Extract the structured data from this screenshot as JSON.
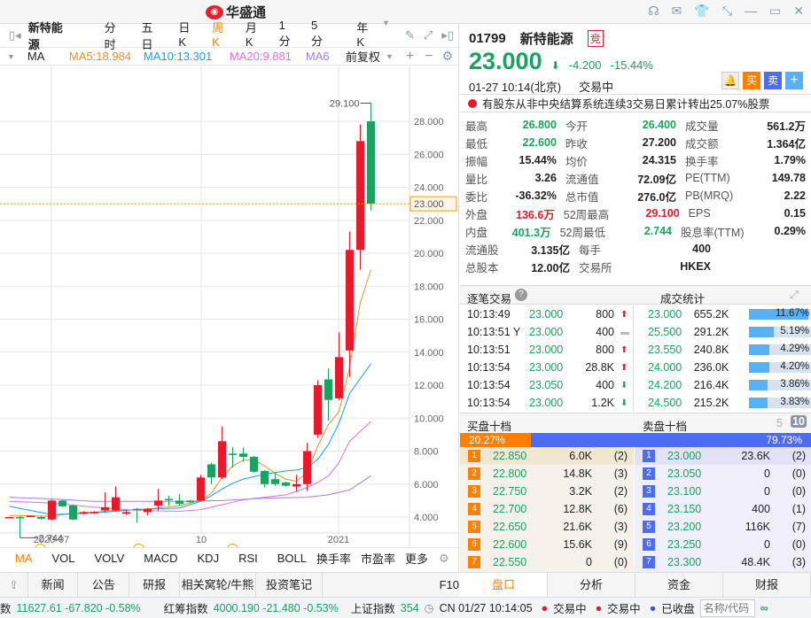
{
  "app": {
    "logo_text": "华盛通"
  },
  "toolbar": {
    "stock_name": "新特能源",
    "periods": [
      "分时",
      "五日",
      "日K",
      "周K",
      "月K",
      "1分",
      "5分",
      "年K"
    ],
    "active_period": "周K"
  },
  "ma_row": {
    "label": "MA",
    "ma5": "MA5:18.984",
    "ma10": "MA10:13.301",
    "ma20": "MA20:9.881",
    "ma60": "MA6",
    "adjust": "前复权"
  },
  "chart_data": {
    "type": "candlestick",
    "yticks": [
      4,
      6,
      8,
      10,
      12,
      14,
      16,
      18,
      20,
      22,
      24,
      26,
      28
    ],
    "ytick_labels": [
      "4.000",
      "6.000",
      "8.000",
      "10.000",
      "12.000",
      "14.000",
      "16.000",
      "18.000",
      "20.000",
      "22.000",
      "24.000",
      "26.000",
      "28.000"
    ],
    "ylim": [
      2.3,
      29.4
    ],
    "current_price_label": "23.000",
    "current_price": 23.0,
    "high_label": "29.100",
    "low_label": "2.744",
    "xlabels": [
      {
        "text": "2020-07",
        "index": 4
      },
      {
        "text": "10",
        "index": 18
      },
      {
        "text": "2021",
        "index": 31
      }
    ],
    "events": [
      {
        "text": "Q",
        "index": 3
      },
      {
        "text": "E",
        "index": 12
      },
      {
        "text": "E",
        "index": 21
      }
    ],
    "up_color": "#e8192c",
    "down_color": "#1aa260",
    "candles": [
      [
        4.0,
        4.0,
        4.02,
        3.97
      ],
      [
        4.0,
        3.95,
        4.05,
        2.744
      ],
      [
        4.05,
        4.08,
        4.1,
        4.0
      ],
      [
        4.0,
        3.9,
        4.05,
        3.85
      ],
      [
        3.85,
        5.0,
        5.05,
        3.8
      ],
      [
        5.0,
        4.65,
        5.05,
        4.6
      ],
      [
        4.7,
        3.85,
        4.75,
        3.8
      ],
      [
        4.2,
        4.3,
        4.35,
        4.15
      ],
      [
        4.25,
        4.3,
        4.35,
        4.2
      ],
      [
        4.4,
        4.6,
        5.5,
        4.3
      ],
      [
        4.4,
        5.2,
        5.85,
        4.35
      ],
      [
        4.2,
        4.3,
        4.4,
        4.15
      ],
      [
        4.5,
        4.45,
        4.55,
        3.65
      ],
      [
        4.3,
        4.5,
        4.55,
        4.1
      ],
      [
        4.7,
        5.0,
        5.7,
        4.4
      ],
      [
        5.1,
        5.05,
        5.3,
        4.7
      ],
      [
        5.0,
        4.8,
        5.4,
        4.7
      ],
      [
        5.0,
        4.9,
        5.05,
        4.85
      ],
      [
        5.0,
        6.4,
        6.55,
        4.95
      ],
      [
        7.2,
        6.4,
        7.3,
        6.0
      ],
      [
        6.4,
        8.6,
        9.5,
        6.3
      ],
      [
        7.85,
        7.8,
        8.25,
        7.0
      ],
      [
        7.85,
        7.65,
        8.2,
        7.35
      ],
      [
        7.65,
        6.75,
        7.7,
        6.7
      ],
      [
        6.8,
        6.0,
        6.85,
        5.8
      ],
      [
        6.3,
        6.0,
        6.7,
        5.9
      ],
      [
        6.1,
        5.9,
        6.15,
        5.85
      ],
      [
        5.85,
        6.0,
        6.55,
        5.55
      ],
      [
        6.0,
        8.0,
        8.5,
        5.6
      ],
      [
        9.0,
        12.0,
        12.3,
        8.8
      ],
      [
        12.35,
        11.1,
        13.0,
        9.85
      ],
      [
        11.2,
        13.7,
        15.2,
        11.1
      ],
      [
        14.1,
        20.2,
        21.3,
        12.5
      ],
      [
        20.2,
        26.8,
        27.8,
        19.0
      ],
      [
        28.0,
        23.0,
        29.1,
        22.6
      ]
    ],
    "ma": [
      {
        "name": "MA5",
        "color": "#e8902c",
        "points": [
          [
            0,
            4.1
          ],
          [
            4,
            4.05
          ],
          [
            6,
            4.25
          ],
          [
            8,
            4.3
          ],
          [
            10,
            4.4
          ],
          [
            12,
            4.45
          ],
          [
            14,
            4.55
          ],
          [
            16,
            4.7
          ],
          [
            18,
            5.0
          ],
          [
            19,
            5.45
          ],
          [
            20,
            6.4
          ],
          [
            21,
            7.1
          ],
          [
            22,
            7.45
          ],
          [
            23,
            7.45
          ],
          [
            24,
            7.1
          ],
          [
            25,
            6.65
          ],
          [
            26,
            6.3
          ],
          [
            27,
            6.17
          ],
          [
            28,
            6.7
          ],
          [
            29,
            8.3
          ],
          [
            30,
            9.6
          ],
          [
            31,
            10.4
          ],
          [
            32,
            13.1
          ],
          [
            33,
            17.0
          ],
          [
            34,
            19.0
          ]
        ]
      },
      {
        "name": "MA10",
        "color": "#1a9de8",
        "points": [
          [
            0,
            4.65
          ],
          [
            2,
            4.4
          ],
          [
            4,
            4.15
          ],
          [
            6,
            4.2
          ],
          [
            8,
            4.25
          ],
          [
            10,
            4.35
          ],
          [
            12,
            4.45
          ],
          [
            14,
            4.5
          ],
          [
            16,
            4.55
          ],
          [
            17,
            4.75
          ],
          [
            18,
            4.95
          ],
          [
            19,
            5.3
          ],
          [
            20,
            5.7
          ],
          [
            21,
            6.05
          ],
          [
            22,
            6.3
          ],
          [
            23,
            6.45
          ],
          [
            24,
            6.6
          ],
          [
            25,
            6.7
          ],
          [
            26,
            6.8
          ],
          [
            27,
            6.85
          ],
          [
            28,
            7.0
          ],
          [
            29,
            7.5
          ],
          [
            30,
            8.4
          ],
          [
            31,
            9.7
          ],
          [
            32,
            11.5
          ],
          [
            34,
            13.3
          ]
        ]
      },
      {
        "name": "MA20",
        "color": "#e070e0",
        "points": [
          [
            0,
            4.95
          ],
          [
            4,
            4.85
          ],
          [
            8,
            4.6
          ],
          [
            12,
            4.4
          ],
          [
            16,
            4.35
          ],
          [
            18,
            4.45
          ],
          [
            20,
            4.75
          ],
          [
            22,
            5.05
          ],
          [
            24,
            5.2
          ],
          [
            26,
            5.35
          ],
          [
            27,
            5.55
          ],
          [
            28,
            5.8
          ],
          [
            29,
            6.1
          ],
          [
            30,
            6.5
          ],
          [
            31,
            7.3
          ],
          [
            32,
            8.6
          ],
          [
            34,
            9.8
          ]
        ]
      },
      {
        "name": "MA60",
        "color": "#9b7ef0",
        "points": [
          [
            0,
            5.2
          ],
          [
            4,
            5.1
          ],
          [
            8,
            4.95
          ],
          [
            16,
            4.95
          ],
          [
            20,
            5.0
          ],
          [
            24,
            5.15
          ],
          [
            28,
            5.2
          ],
          [
            30,
            5.35
          ],
          [
            32,
            5.65
          ],
          [
            34,
            6.5
          ]
        ]
      }
    ]
  },
  "indicators": [
    "MA",
    "VOL",
    "VOLV",
    "MACD",
    "KDJ",
    "RSI",
    "BOLL",
    "换手率",
    "市盈率",
    "更多"
  ],
  "news_tabs": [
    "新闻",
    "公告",
    "研报",
    "相关窝轮/牛熊",
    "投资笔记",
    "F10"
  ],
  "quote": {
    "code": "01799",
    "name": "新特能源",
    "badge": "竞",
    "price": "23.000",
    "change": "-4.200",
    "pct": "-15.44%",
    "time": "01-27  10:14(北京)",
    "status": "交易中",
    "buy": "买",
    "sell": "卖",
    "notice": "有股东从非中央结算系统连续3交易日累计转出25.07%股票"
  },
  "stats": [
    [
      [
        "最高",
        "26.800",
        "g"
      ],
      [
        "今开",
        "26.400",
        "g"
      ],
      [
        "成交量",
        "561.2万",
        ""
      ]
    ],
    [
      [
        "最低",
        "22.600",
        "g"
      ],
      [
        "昨收",
        "27.200",
        ""
      ],
      [
        "成交额",
        "1.364亿",
        ""
      ]
    ],
    [
      [
        "振幅",
        "15.44%",
        ""
      ],
      [
        "均价",
        "24.315",
        ""
      ],
      [
        "换手率",
        "1.79%",
        ""
      ]
    ],
    [
      [
        "量比",
        "3.26",
        ""
      ],
      [
        "流通值",
        "72.09亿",
        ""
      ],
      [
        "PE(TTM)",
        "149.78",
        ""
      ]
    ],
    [
      [
        "委比",
        "-36.32%",
        ""
      ],
      [
        "总市值",
        "276.0亿",
        ""
      ],
      [
        "PB(MRQ)",
        "2.22",
        ""
      ]
    ],
    [
      [
        "外盘",
        "136.6万",
        "r"
      ],
      [
        "52周最高",
        "29.100",
        "r"
      ],
      [
        "EPS",
        "0.15",
        ""
      ]
    ],
    [
      [
        "内盘",
        "401.3万",
        "g"
      ],
      [
        "52周最低",
        "2.744",
        "g"
      ],
      [
        "股息率(TTM)",
        "0.29%",
        ""
      ]
    ],
    [
      [
        "流通股",
        "3.135亿",
        ""
      ],
      [
        "每手",
        "400",
        ""
      ]
    ],
    [
      [
        "总股本",
        "12.00亿",
        ""
      ],
      [
        "交易所",
        "HKEX",
        ""
      ]
    ]
  ],
  "ticks_header": {
    "left": "逐笔交易",
    "right": "成交统计"
  },
  "ticks": [
    [
      "10:13:49",
      "23.000",
      "800",
      "up"
    ],
    [
      "10:13:51 Y",
      "23.000",
      "400",
      "flat"
    ],
    [
      "10:13:51",
      "23.000",
      "800",
      "up"
    ],
    [
      "10:13:54",
      "23.000",
      "28.8K",
      "up"
    ],
    [
      "10:13:54",
      "23.050",
      "400",
      "down"
    ],
    [
      "10:13:54",
      "23.000",
      "1.2K",
      "down"
    ]
  ],
  "volstats": [
    [
      "23.000",
      "655.2K",
      "11.67%",
      0.95
    ],
    [
      "25.500",
      "291.2K",
      "5.19%",
      0.4
    ],
    [
      "23.550",
      "240.8K",
      "4.29%",
      0.33
    ],
    [
      "24.000",
      "236.0K",
      "4.20%",
      0.33
    ],
    [
      "24.200",
      "216.4K",
      "3.86%",
      0.3
    ],
    [
      "24.500",
      "215.2K",
      "3.83%",
      0.3
    ]
  ],
  "book": {
    "buy_title": "买盘十档",
    "sell_title": "卖盘十档",
    "opt5": "5",
    "opt10": "10",
    "buy_pct": "20.27%",
    "sell_pct": "79.73%",
    "buy_ratio": 0.2027,
    "bids": [
      [
        "1",
        "22.850",
        "6.0K",
        "(2)"
      ],
      [
        "2",
        "22.800",
        "14.8K",
        "(3)"
      ],
      [
        "3",
        "22.750",
        "3.2K",
        "(2)"
      ],
      [
        "4",
        "22.700",
        "12.8K",
        "(6)"
      ],
      [
        "5",
        "22.650",
        "21.6K",
        "(3)"
      ],
      [
        "6",
        "22.600",
        "15.6K",
        "(9)"
      ],
      [
        "7",
        "22.550",
        "0",
        "(0)"
      ]
    ],
    "asks": [
      [
        "1",
        "23.000",
        "23.6K",
        "(2)"
      ],
      [
        "2",
        "23.050",
        "0",
        "(0)"
      ],
      [
        "3",
        "23.100",
        "0",
        "(0)"
      ],
      [
        "4",
        "23.150",
        "400",
        "(1)"
      ],
      [
        "5",
        "23.200",
        "116K",
        "(7)"
      ],
      [
        "6",
        "23.250",
        "0",
        "(0)"
      ],
      [
        "7",
        "23.300",
        "48.4K",
        "(3)"
      ]
    ]
  },
  "right_tabs": [
    "盘口",
    "分析",
    "资金",
    "财报"
  ],
  "statusbar": {
    "idx1": "数",
    "idx1_vals": "11627.61 -67.820 -0.58%",
    "idx2": "红筹指数",
    "idx2_vals": "4000.190 -21.480 -0.53%",
    "idx3": "上证指数",
    "idx3_vals": "354",
    "clock": "CN 01/27 10:14:05",
    "hk": "交易中",
    "cn": "交易中",
    "us": "已收盘",
    "search_placeholder": "名称/代码"
  }
}
